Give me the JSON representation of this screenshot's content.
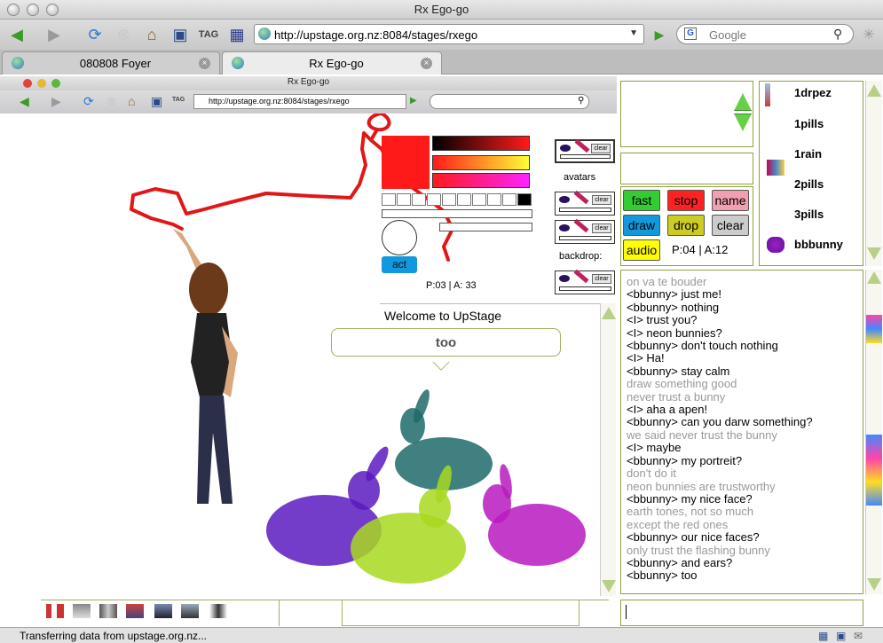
{
  "window": {
    "title": "Rx Ego-go"
  },
  "toolbar": {
    "url": "http://upstage.org.nz:8084/stages/rxego",
    "search_placeholder": "Google",
    "icons": [
      "back-icon",
      "forward-icon",
      "reload-icon",
      "stop-icon",
      "home-icon",
      "bookmark-icon",
      "tag-icon",
      "delicious-icon"
    ]
  },
  "tabs": [
    {
      "label": "080808 Foyer",
      "active": false
    },
    {
      "label": "Rx Ego-go",
      "active": true
    }
  ],
  "inner_window": {
    "title": "Rx Ego-go",
    "url": "http://upstage.org.nz:8084/stages/rxego"
  },
  "palette": {
    "avatars_label": "avatars",
    "backdrop_label": "backdrop:",
    "act_label": "act",
    "pa_left": "P:03 | A: 33",
    "clear_label": "clear",
    "color": "#ff1a1a"
  },
  "stage": {
    "welcome": "Welcome to UpStage",
    "bubble_text": "too"
  },
  "controls": {
    "buttons": [
      {
        "label": "fast",
        "color": "#33cc33"
      },
      {
        "label": "stop",
        "color": "#ff2222"
      },
      {
        "label": "name",
        "color": "#f0a0b0"
      },
      {
        "label": "draw",
        "color": "#1199dd"
      },
      {
        "label": "drop",
        "color": "#cccc22"
      },
      {
        "label": "clear",
        "color": "#cccccc"
      },
      {
        "label": "audio",
        "color": "#ffff00"
      }
    ],
    "pa_right": "P:04 | A:12"
  },
  "avatars": [
    "1drpez",
    "1pills",
    "1rain",
    "2pills",
    "3pills",
    "bbbunny"
  ],
  "chat": [
    {
      "text": "on va te bouder",
      "dim": true
    },
    {
      "text": "<bbunny> just me!",
      "dim": false
    },
    {
      "text": "<bbunny> nothing",
      "dim": false
    },
    {
      "text": "<I> trust you?",
      "dim": false
    },
    {
      "text": "<I> neon bunnies?",
      "dim": false
    },
    {
      "text": "<bbunny> don't touch nothing",
      "dim": false
    },
    {
      "text": "<I> Ha!",
      "dim": false
    },
    {
      "text": "<bbunny> stay calm",
      "dim": false
    },
    {
      "text": "draw something good",
      "dim": true
    },
    {
      "text": "never trust a bunny",
      "dim": true
    },
    {
      "text": "<I> aha a apen!",
      "dim": false
    },
    {
      "text": "<bbunny> can you darw something?",
      "dim": false
    },
    {
      "text": "we said never trust the bunny",
      "dim": true
    },
    {
      "text": "<I> maybe",
      "dim": false
    },
    {
      "text": "<bbunny> my portreit?",
      "dim": false
    },
    {
      "text": "don't do it",
      "dim": true
    },
    {
      "text": "neon bunnies are trustworthy",
      "dim": true
    },
    {
      "text": "<bbunny> my nice face?",
      "dim": false
    },
    {
      "text": "earth tones, not so much",
      "dim": true
    },
    {
      "text": "except the red ones",
      "dim": true
    },
    {
      "text": "<bbunny> our nice faces?",
      "dim": false
    },
    {
      "text": "only trust the flashing bunny",
      "dim": true
    },
    {
      "text": "<bbunny> and ears?",
      "dim": false
    },
    {
      "text": "<bbunny> too",
      "dim": false
    }
  ],
  "status": {
    "text": "Transferring data from upstage.org.nz..."
  }
}
